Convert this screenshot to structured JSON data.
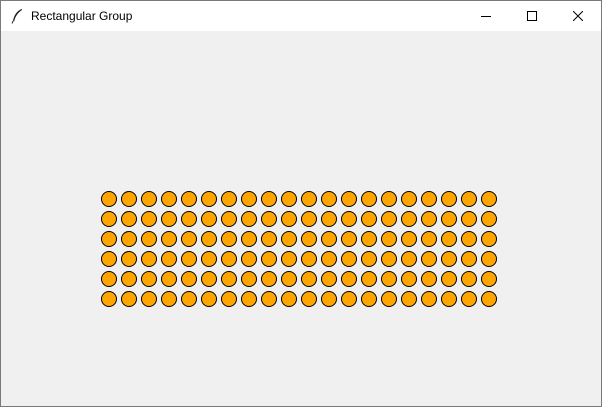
{
  "window": {
    "title": "Rectangular Group",
    "icons": {
      "app": "feather-icon",
      "minimize": "minimize-icon",
      "maximize": "maximize-icon",
      "close": "close-icon"
    }
  },
  "grid": {
    "rows": 6,
    "columns": 20,
    "fill_color": "#FFA500",
    "stroke_color": "#000000",
    "background_color": "#F0F0F0"
  }
}
